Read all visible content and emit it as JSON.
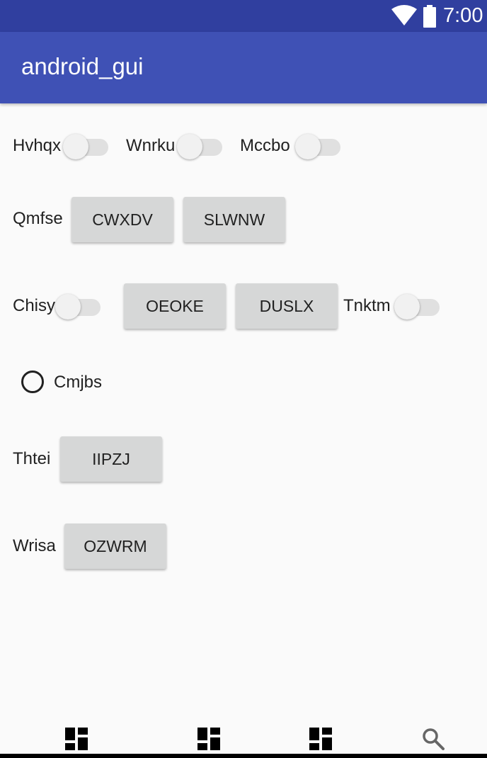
{
  "status_bar": {
    "time": "7:00"
  },
  "app_bar": {
    "title": "android_gui"
  },
  "row1": {
    "switch1_label": "Hvhqx",
    "switch2_label": "Wnrku",
    "switch3_label": "Mccbo"
  },
  "row2": {
    "label": "Qmfse",
    "button1": "CWXDV",
    "button2": "SLWNW"
  },
  "row3": {
    "switch1_label": "Chisy",
    "button1": "OEOKE",
    "button2": "DUSLX",
    "switch2_label": "Tnktm"
  },
  "row4": {
    "radio_label": "Cmjbs"
  },
  "row5": {
    "label": "Thtei",
    "button": "IIPZJ"
  },
  "row6": {
    "label": "Wrisa",
    "button": "OZWRM"
  },
  "bottom_nav": {
    "icons": [
      "dashboard-icon",
      "dashboard-icon",
      "dashboard-icon",
      "search-icon"
    ]
  },
  "colors": {
    "status_bar": "#303f9f",
    "app_bar": "#3f51b5",
    "background": "#fafafa",
    "button": "#d6d7d7"
  }
}
